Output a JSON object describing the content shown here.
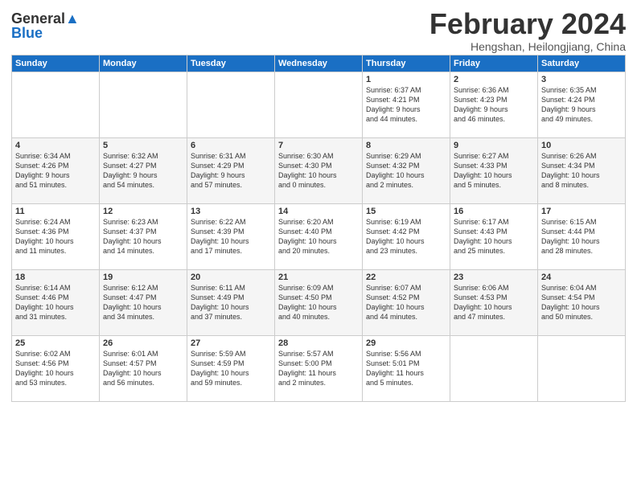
{
  "logo": {
    "line1": "General",
    "line2": "Blue"
  },
  "title": "February 2024",
  "subtitle": "Hengshan, Heilongjiang, China",
  "days_of_week": [
    "Sunday",
    "Monday",
    "Tuesday",
    "Wednesday",
    "Thursday",
    "Friday",
    "Saturday"
  ],
  "weeks": [
    [
      {
        "day": "",
        "content": ""
      },
      {
        "day": "",
        "content": ""
      },
      {
        "day": "",
        "content": ""
      },
      {
        "day": "",
        "content": ""
      },
      {
        "day": "1",
        "content": "Sunrise: 6:37 AM\nSunset: 4:21 PM\nDaylight: 9 hours\nand 44 minutes."
      },
      {
        "day": "2",
        "content": "Sunrise: 6:36 AM\nSunset: 4:23 PM\nDaylight: 9 hours\nand 46 minutes."
      },
      {
        "day": "3",
        "content": "Sunrise: 6:35 AM\nSunset: 4:24 PM\nDaylight: 9 hours\nand 49 minutes."
      }
    ],
    [
      {
        "day": "4",
        "content": "Sunrise: 6:34 AM\nSunset: 4:26 PM\nDaylight: 9 hours\nand 51 minutes."
      },
      {
        "day": "5",
        "content": "Sunrise: 6:32 AM\nSunset: 4:27 PM\nDaylight: 9 hours\nand 54 minutes."
      },
      {
        "day": "6",
        "content": "Sunrise: 6:31 AM\nSunset: 4:29 PM\nDaylight: 9 hours\nand 57 minutes."
      },
      {
        "day": "7",
        "content": "Sunrise: 6:30 AM\nSunset: 4:30 PM\nDaylight: 10 hours\nand 0 minutes."
      },
      {
        "day": "8",
        "content": "Sunrise: 6:29 AM\nSunset: 4:32 PM\nDaylight: 10 hours\nand 2 minutes."
      },
      {
        "day": "9",
        "content": "Sunrise: 6:27 AM\nSunset: 4:33 PM\nDaylight: 10 hours\nand 5 minutes."
      },
      {
        "day": "10",
        "content": "Sunrise: 6:26 AM\nSunset: 4:34 PM\nDaylight: 10 hours\nand 8 minutes."
      }
    ],
    [
      {
        "day": "11",
        "content": "Sunrise: 6:24 AM\nSunset: 4:36 PM\nDaylight: 10 hours\nand 11 minutes."
      },
      {
        "day": "12",
        "content": "Sunrise: 6:23 AM\nSunset: 4:37 PM\nDaylight: 10 hours\nand 14 minutes."
      },
      {
        "day": "13",
        "content": "Sunrise: 6:22 AM\nSunset: 4:39 PM\nDaylight: 10 hours\nand 17 minutes."
      },
      {
        "day": "14",
        "content": "Sunrise: 6:20 AM\nSunset: 4:40 PM\nDaylight: 10 hours\nand 20 minutes."
      },
      {
        "day": "15",
        "content": "Sunrise: 6:19 AM\nSunset: 4:42 PM\nDaylight: 10 hours\nand 23 minutes."
      },
      {
        "day": "16",
        "content": "Sunrise: 6:17 AM\nSunset: 4:43 PM\nDaylight: 10 hours\nand 25 minutes."
      },
      {
        "day": "17",
        "content": "Sunrise: 6:15 AM\nSunset: 4:44 PM\nDaylight: 10 hours\nand 28 minutes."
      }
    ],
    [
      {
        "day": "18",
        "content": "Sunrise: 6:14 AM\nSunset: 4:46 PM\nDaylight: 10 hours\nand 31 minutes."
      },
      {
        "day": "19",
        "content": "Sunrise: 6:12 AM\nSunset: 4:47 PM\nDaylight: 10 hours\nand 34 minutes."
      },
      {
        "day": "20",
        "content": "Sunrise: 6:11 AM\nSunset: 4:49 PM\nDaylight: 10 hours\nand 37 minutes."
      },
      {
        "day": "21",
        "content": "Sunrise: 6:09 AM\nSunset: 4:50 PM\nDaylight: 10 hours\nand 40 minutes."
      },
      {
        "day": "22",
        "content": "Sunrise: 6:07 AM\nSunset: 4:52 PM\nDaylight: 10 hours\nand 44 minutes."
      },
      {
        "day": "23",
        "content": "Sunrise: 6:06 AM\nSunset: 4:53 PM\nDaylight: 10 hours\nand 47 minutes."
      },
      {
        "day": "24",
        "content": "Sunrise: 6:04 AM\nSunset: 4:54 PM\nDaylight: 10 hours\nand 50 minutes."
      }
    ],
    [
      {
        "day": "25",
        "content": "Sunrise: 6:02 AM\nSunset: 4:56 PM\nDaylight: 10 hours\nand 53 minutes."
      },
      {
        "day": "26",
        "content": "Sunrise: 6:01 AM\nSunset: 4:57 PM\nDaylight: 10 hours\nand 56 minutes."
      },
      {
        "day": "27",
        "content": "Sunrise: 5:59 AM\nSunset: 4:59 PM\nDaylight: 10 hours\nand 59 minutes."
      },
      {
        "day": "28",
        "content": "Sunrise: 5:57 AM\nSunset: 5:00 PM\nDaylight: 11 hours\nand 2 minutes."
      },
      {
        "day": "29",
        "content": "Sunrise: 5:56 AM\nSunset: 5:01 PM\nDaylight: 11 hours\nand 5 minutes."
      },
      {
        "day": "",
        "content": ""
      },
      {
        "day": "",
        "content": ""
      }
    ]
  ]
}
